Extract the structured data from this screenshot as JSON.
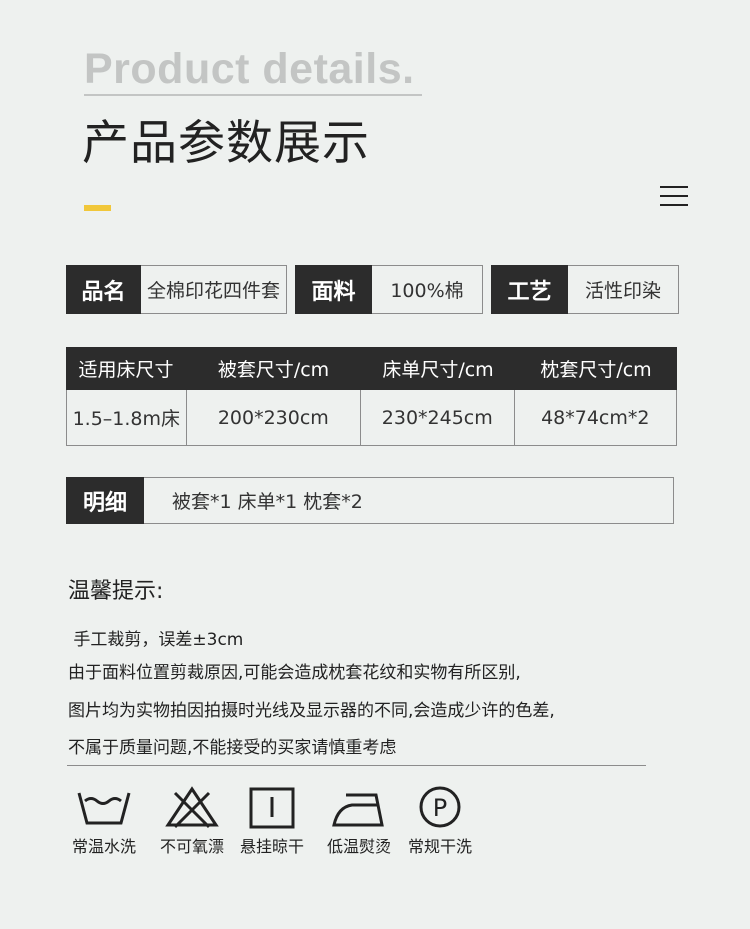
{
  "hero": {
    "title_en": "Product details.",
    "title_cn": "产品参数展示"
  },
  "colors": {
    "accent": "#f1c73a",
    "label_bg": "#2c2c2c",
    "background": "#eef1ef"
  },
  "attributes": [
    {
      "key": "品名",
      "value": "全棉印花四件套"
    },
    {
      "key": "面料",
      "value": "100%棉"
    },
    {
      "key": "工艺",
      "value": "活性印染"
    }
  ],
  "size_table": {
    "headers": [
      "适用床尺寸",
      "被套尺寸/cm",
      "床单尺寸/cm",
      "枕套尺寸/cm"
    ],
    "row": [
      "1.5–1.8m床",
      "200*230cm",
      "230*245cm",
      "48*74cm*2"
    ]
  },
  "detail": {
    "key": "明细",
    "value": "被套*1 床单*1 枕套*2"
  },
  "tips": {
    "title": "温馨提示:",
    "lines": [
      " 手工裁剪，误差±3cm",
      "由于面料位置剪裁原因,可能会造成枕套花纹和实物有所区别,",
      "图片均为实物拍因拍摄时光线及显示器的不同,会造成少许的色差,",
      "不属于质量问题,不能接受的买家请慎重考虑"
    ]
  },
  "care": [
    {
      "icon": "wash-basin-icon",
      "label": "常温水洗"
    },
    {
      "icon": "no-bleach-icon",
      "label": "不可氧漂"
    },
    {
      "icon": "hang-dry-icon",
      "label": "悬挂晾干"
    },
    {
      "icon": "iron-low-icon",
      "label": "低温熨烫"
    },
    {
      "icon": "dry-clean-p-icon",
      "label": "常规干洗"
    }
  ]
}
